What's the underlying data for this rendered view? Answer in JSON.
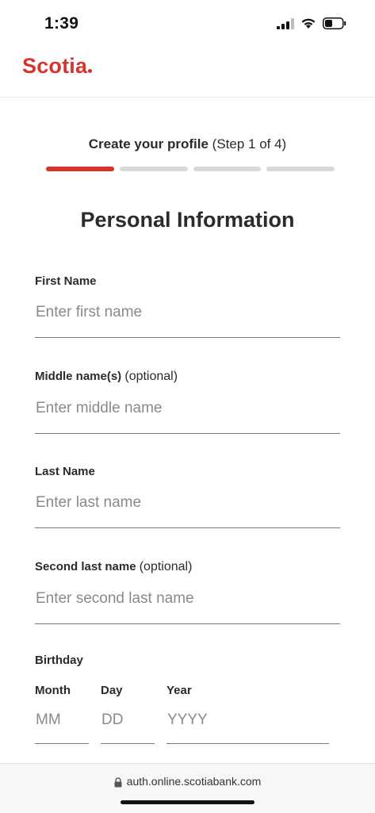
{
  "status_bar": {
    "time": "1:39",
    "icons": [
      "cellular-signal-icon",
      "wifi-icon",
      "battery-icon"
    ]
  },
  "header": {
    "logo_text": "Scotia",
    "brand_color": "#d6342f"
  },
  "progress": {
    "title": "Create your profile",
    "step_text": "(Step 1 of 4)",
    "current_step": 1,
    "total_steps": 4
  },
  "page_title": "Personal Information",
  "fields": {
    "first_name": {
      "label": "First Name",
      "optional_text": "",
      "placeholder": "Enter first name",
      "value": ""
    },
    "middle_name": {
      "label": "Middle name(s)",
      "optional_text": "(optional)",
      "placeholder": "Enter middle name",
      "value": ""
    },
    "last_name": {
      "label": "Last Name",
      "optional_text": "",
      "placeholder": "Enter last name",
      "value": ""
    },
    "second_last_name": {
      "label": "Second last name",
      "optional_text": "(optional)",
      "placeholder": "Enter second last name",
      "value": ""
    }
  },
  "birthday": {
    "label": "Birthday",
    "month": {
      "label": "Month",
      "placeholder": "MM"
    },
    "day": {
      "label": "Day",
      "placeholder": "DD"
    },
    "year": {
      "label": "Year",
      "placeholder": "YYYY"
    }
  },
  "browser": {
    "url": "auth.online.scotiabank.com",
    "lock_icon": "lock-icon"
  }
}
